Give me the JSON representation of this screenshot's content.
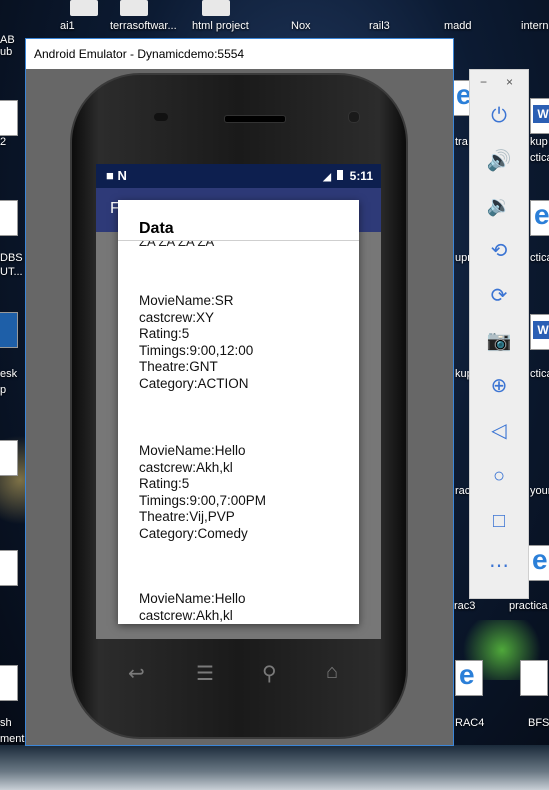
{
  "desktop": {
    "top_icons": [
      "ai1",
      "terrasoftwar...",
      "html project",
      "Nox",
      "rail3",
      "madd",
      "intern"
    ],
    "left_labels": [
      "AB",
      "ub",
      "2",
      "DBS",
      "UT...",
      "esk",
      "p",
      "sh",
      "ment"
    ],
    "right_labels": [
      "kup",
      "ctica",
      "ctica",
      "ctica",
      "your",
      "practica",
      "RAC4",
      "BFS",
      "rac3",
      "tra",
      "upr",
      "kup",
      "rac"
    ]
  },
  "window": {
    "title": "Android Emulator - Dynamicdemo:5554"
  },
  "status_bar": {
    "left": "■ N",
    "right": "5:11"
  },
  "app_bar": {
    "partial_title": "F"
  },
  "dialog": {
    "title": "Data",
    "cut_off_line": "ZA ZA ZA ZA",
    "records": [
      {
        "movie_name": "MovieName:SR",
        "castcrew": "castcrew:XY",
        "rating": "Rating:5",
        "timings": "Timings:9:00,12:00",
        "theatre": "Theatre:GNT",
        "category": "Category:ACTION"
      },
      {
        "movie_name": "MovieName:Hello",
        "castcrew": "castcrew:Akh,kl",
        "rating": "Rating:5",
        "timings": "Timings:9:00,7:00PM",
        "theatre": "Theatre:Vij,PVP",
        "category": "Category:Comedy"
      },
      {
        "movie_name": "MovieName:Hello",
        "castcrew": "castcrew:Akh,kl"
      }
    ]
  },
  "emulator_controls": {
    "minimize": "−",
    "close": "×",
    "buttons": [
      "power-icon",
      "volume-up-icon",
      "volume-down-icon",
      "rotate-left-icon",
      "rotate-right-icon",
      "camera-icon",
      "zoom-icon",
      "back-icon",
      "home-icon",
      "overview-icon",
      "more-icon"
    ]
  }
}
